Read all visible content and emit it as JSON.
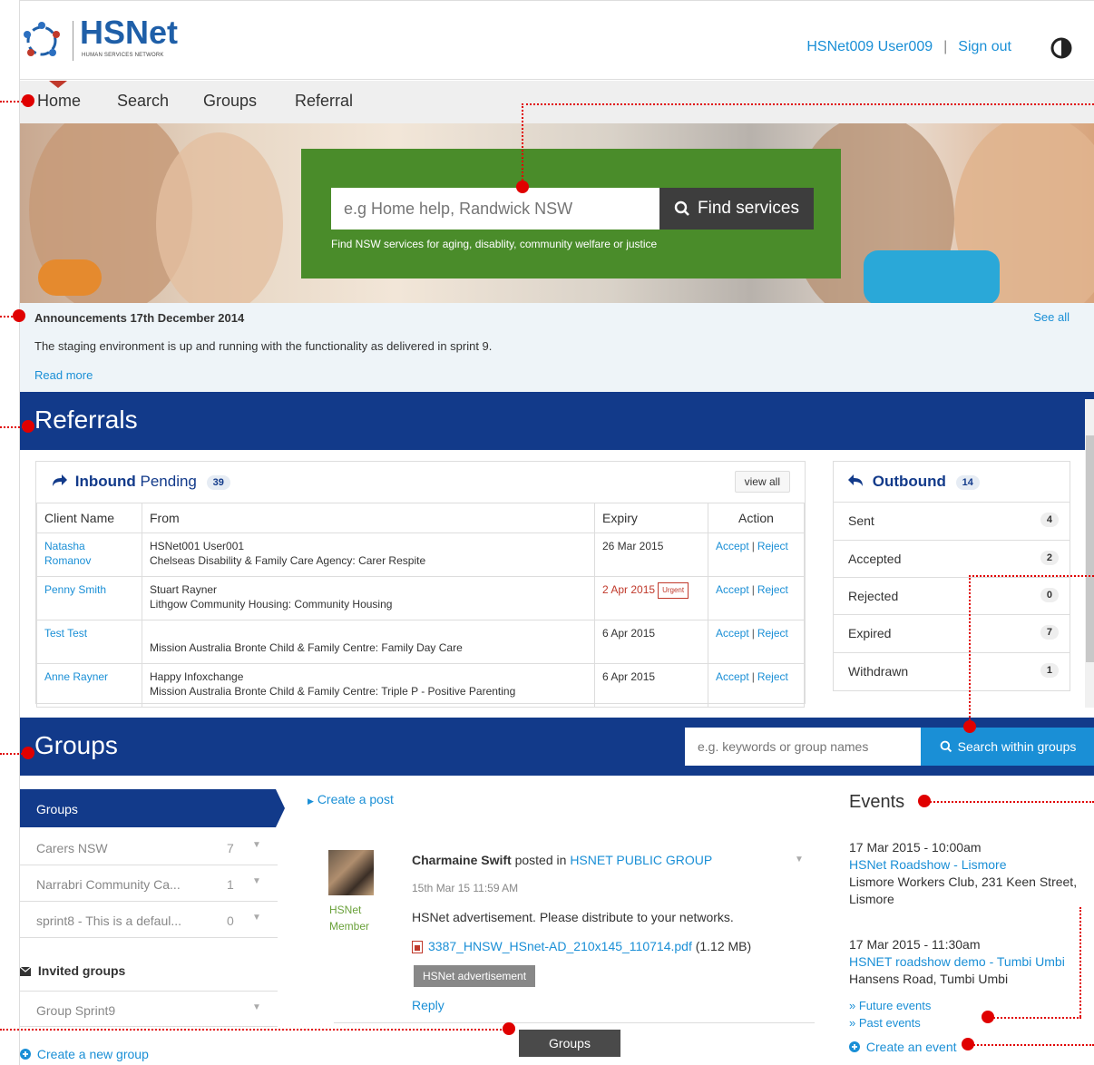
{
  "header": {
    "logo_title": "HSNet",
    "logo_subtitle": "HUMAN SERVICES NETWORK",
    "user_name": "HSNet009 User009",
    "separator": "|",
    "sign_out": "Sign out"
  },
  "nav": {
    "items": [
      {
        "label": "Home"
      },
      {
        "label": "Search"
      },
      {
        "label": "Groups"
      },
      {
        "label": "Referral"
      }
    ]
  },
  "hero": {
    "search_placeholder": "e.g Home help, Randwick NSW",
    "search_button": "Find services",
    "help_text": "Find NSW services for aging, disablity, community welfare or justice"
  },
  "announcements": {
    "title": "Announcements 17th December 2014",
    "see_all": "See all",
    "body": "The staging environment is up and running with the functionality as delivered in sprint 9.",
    "read_more": "Read more"
  },
  "referrals": {
    "title": "Referrals",
    "inbound": {
      "title_bold": "Inbound",
      "title_rest": "Pending",
      "count": "39",
      "view_all": "view all",
      "columns": [
        "Client Name",
        "From",
        "Expiry",
        "Action"
      ],
      "rows": [
        {
          "client": "Natasha Romanov",
          "from_line1": "HSNet001 User001",
          "from_line2": "Chelseas Disability & Family Care Agency: Carer Respite",
          "expiry": "26 Mar 2015",
          "urgent": "",
          "accept": "Accept",
          "reject": "Reject"
        },
        {
          "client": "Penny Smith",
          "from_line1": "Stuart Rayner",
          "from_line2": "Lithgow Community Housing: Community Housing",
          "expiry": "2 Apr 2015",
          "urgent": "Urgent",
          "accept": "Accept",
          "reject": "Reject"
        },
        {
          "client": "Test Test",
          "from_line1": "",
          "from_line2": "Mission Australia Bronte Child & Family Centre: Family Day Care",
          "expiry": "6 Apr 2015",
          "urgent": "",
          "accept": "Accept",
          "reject": "Reject"
        },
        {
          "client": "Anne Rayner",
          "from_line1": "Happy Infoxchange",
          "from_line2": "Mission Australia Bronte Child & Family Centre: Triple P - Positive Parenting",
          "expiry": "6 Apr 2015",
          "urgent": "",
          "accept": "Accept",
          "reject": "Reject"
        }
      ]
    },
    "outbound": {
      "title": "Outbound",
      "count": "14",
      "rows": [
        {
          "label": "Sent",
          "count": "4"
        },
        {
          "label": "Accepted",
          "count": "2"
        },
        {
          "label": "Rejected",
          "count": "0"
        },
        {
          "label": "Expired",
          "count": "7"
        },
        {
          "label": "Withdrawn",
          "count": "1"
        }
      ]
    }
  },
  "groups": {
    "title": "Groups",
    "search_placeholder": "e.g. keywords or group names",
    "search_button": "Search within groups",
    "sidebar_head": "Groups",
    "list": [
      {
        "name": "Carers NSW",
        "count": "7"
      },
      {
        "name": "Narrabri Community Ca...",
        "count": "1"
      },
      {
        "name": "sprint8 - This is a defaul...",
        "count": "0"
      }
    ],
    "invited_title": "Invited groups",
    "invited": [
      {
        "name": "Group Sprint9"
      }
    ],
    "create_group": "Create a new group",
    "create_post": "Create a post",
    "post": {
      "author": "Charmaine Swift",
      "posted_in": "posted in",
      "group": "HSNET PUBLIC GROUP",
      "date": "15th Mar 15 11:59 AM",
      "member_line1": "HSNet",
      "member_line2": "Member",
      "body": "HSNet advertisement. Please distribute to your networks.",
      "file_name": "3387_HNSW_HSnet-AD_210x145_110714.pdf",
      "file_size": "(1.12 MB)",
      "tag": "HSNet advertisement",
      "reply": "Reply"
    },
    "groups_button": "Groups"
  },
  "events": {
    "title": "Events",
    "items": [
      {
        "when": "17 Mar 2015 - 10:00am",
        "what": "HSNet Roadshow - Lismore",
        "where_line1": "Lismore Workers Club, 231 Keen Street,",
        "where_line2": "Lismore"
      },
      {
        "when": "17 Mar 2015 - 11:30am",
        "what": "HSNET roadshow demo - Tumbi Umbi",
        "where_line1": "Hansens Road, Tumbi Umbi",
        "where_line2": ""
      }
    ],
    "future": "» Future events",
    "past": "» Past events",
    "create": "Create an event"
  },
  "colors": {
    "brand_navy": "#123a8a",
    "accent_blue": "#1a8fd6",
    "hero_green": "#4a8c2a",
    "urgent_red": "#c0392b",
    "marker_red": "#e00000"
  }
}
